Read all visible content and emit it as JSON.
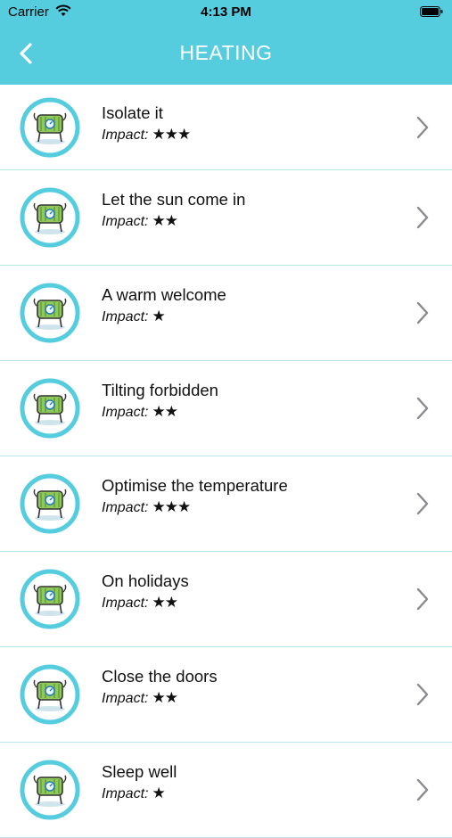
{
  "status_bar": {
    "carrier": "Carrier",
    "time": "4:13 PM"
  },
  "nav": {
    "title": "HEATING"
  },
  "items": [
    {
      "title": "Isolate it",
      "impact_label": "Impact:",
      "stars": "★★★"
    },
    {
      "title": "Let the sun come in",
      "impact_label": "Impact:",
      "stars": "★★"
    },
    {
      "title": "A warm welcome",
      "impact_label": "Impact:",
      "stars": "★"
    },
    {
      "title": "Tilting forbidden",
      "impact_label": "Impact:",
      "stars": "★★"
    },
    {
      "title": "Optimise the temperature",
      "impact_label": "Impact:",
      "stars": "★★★"
    },
    {
      "title": "On holidays",
      "impact_label": "Impact:",
      "stars": "★★"
    },
    {
      "title": "Close the doors",
      "impact_label": "Impact:",
      "stars": "★★"
    },
    {
      "title": "Sleep well",
      "impact_label": "Impact:",
      "stars": "★"
    }
  ],
  "colors": {
    "accent": "#55cddf",
    "separator": "#b9e4ec",
    "radiator": "#8fc95a"
  },
  "icons": {
    "back": "chevron-left-icon",
    "disclosure": "chevron-right-icon",
    "item": "radiator-icon"
  }
}
